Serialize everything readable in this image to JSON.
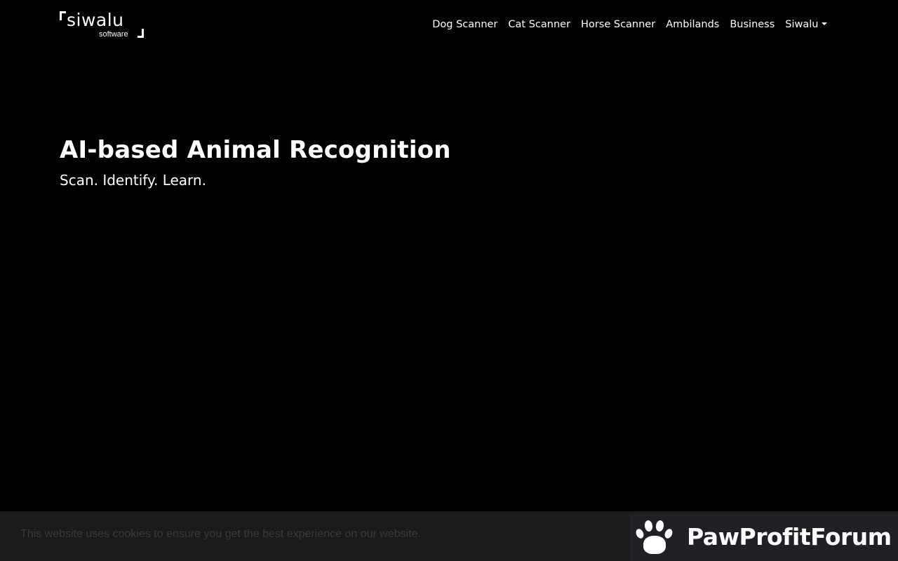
{
  "brand": {
    "name": "siwalu",
    "tagline": "software"
  },
  "nav": {
    "items": [
      {
        "label": "Dog Scanner"
      },
      {
        "label": "Cat Scanner"
      },
      {
        "label": "Horse Scanner"
      },
      {
        "label": "Ambilands"
      },
      {
        "label": "Business"
      }
    ],
    "dropdown_label": "Siwalu"
  },
  "hero": {
    "title": "AI-based Animal Recognition",
    "subtitle": "Scan. Identify. Learn."
  },
  "cookie": {
    "message": "This website uses cookies to ensure you get the best experience on our website."
  },
  "watermark": {
    "text": "PawProfitForum",
    "icon": "paw-icon"
  },
  "colors": {
    "background": "#000000",
    "cookie_bar": "#1b1b1b",
    "cookie_text": "#3a3a3a",
    "badge_bg": "#1f2127"
  }
}
